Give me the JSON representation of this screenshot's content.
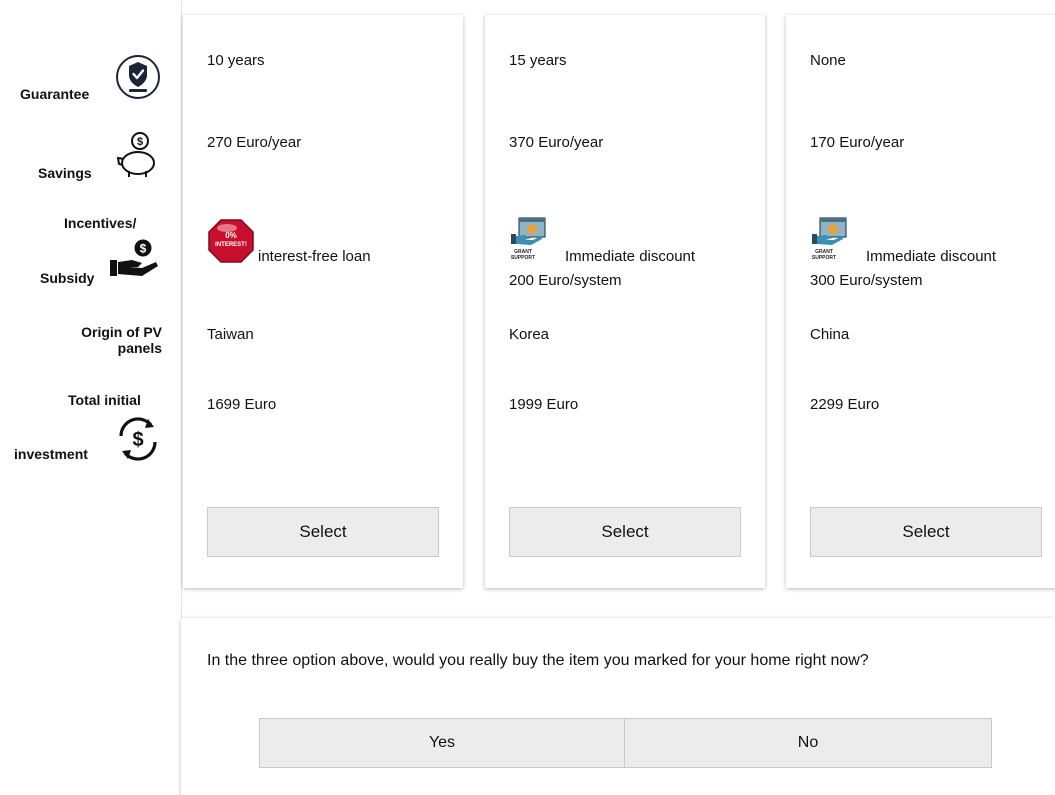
{
  "rows": {
    "guarantee": "Guarantee",
    "savings": "Savings",
    "incentives_line1": "Incentives/",
    "incentives_line2": "Subsidy",
    "origin_line1": "Origin of PV",
    "origin_line2": "panels",
    "investment_line1": "Total initial",
    "investment_line2": "investment"
  },
  "icons": {
    "guarantee": "guarantee-badge-icon",
    "savings": "piggy-bank-icon",
    "subsidy": "hand-coin-icon",
    "investment": "dollar-cycle-icon",
    "loan": "zero-interest-stop-sign-icon",
    "discount": "grant-support-icon"
  },
  "options": [
    {
      "guarantee": "10 years",
      "savings": "270 Euro/year",
      "subsidy_line1": "interest-free loan",
      "subsidy_line2": "",
      "origin": "Taiwan",
      "investment": "1699 Euro",
      "select_label": "Select"
    },
    {
      "guarantee": "15 years",
      "savings": "370 Euro/year",
      "subsidy_line1": "Immediate discount",
      "subsidy_line2": "200 Euro/system",
      "origin": "Korea",
      "investment": "1999 Euro",
      "select_label": "Select"
    },
    {
      "guarantee": "None",
      "savings": "170 Euro/year",
      "subsidy_line1": "Immediate discount",
      "subsidy_line2": "300 Euro/system",
      "origin": "China",
      "investment": "2299 Euro",
      "select_label": "Select"
    }
  ],
  "loan_badge_text": "0% INTEREST!",
  "grant_badge_text": "GRANT SUPPORT",
  "question": {
    "text": "In the three option above, would you really buy the item you marked for your home right now?",
    "yes_label": "Yes",
    "no_label": "No"
  },
  "colors": {
    "button_bg": "#ececec",
    "loan_red": "#c8102e"
  }
}
